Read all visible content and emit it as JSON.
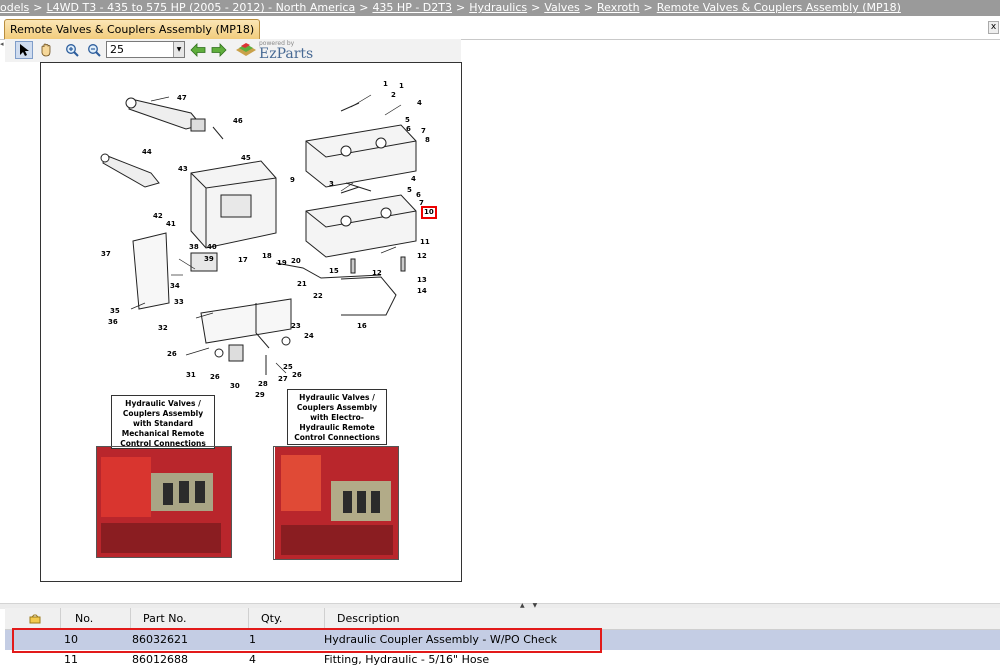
{
  "breadcrumb": {
    "items": [
      "odels",
      "L4WD T3 - 435 to 575 HP (2005 - 2012) - North America",
      "435 HP - D2T3",
      "Hydraulics",
      "Valves",
      "Rexroth",
      "Remote Valves & Couplers Assembly (MP18)"
    ],
    "separator": ">"
  },
  "tab": {
    "title": "Remote Valves & Couplers Assembly (MP18)",
    "close_glyph": "x"
  },
  "toolbar": {
    "zoom_value": "25",
    "logo_powered": "powered by",
    "logo_name": "EzParts",
    "tools": [
      "select-pointer",
      "pan-hand",
      "zoom-in",
      "zoom-out",
      "back-arrow",
      "forward-arrow"
    ]
  },
  "diagram": {
    "part_labels": [
      "1",
      "2",
      "4",
      "5",
      "6",
      "7",
      "8",
      "47",
      "46",
      "44",
      "43",
      "45",
      "9",
      "3",
      "4",
      "5",
      "6",
      "7",
      "10",
      "11",
      "12",
      "13",
      "14",
      "15",
      "12",
      "16",
      "42",
      "41",
      "38",
      "40",
      "39",
      "17",
      "18",
      "19",
      "20",
      "21",
      "22",
      "37",
      "34",
      "33",
      "35",
      "36",
      "32",
      "23",
      "24",
      "25",
      "26",
      "27",
      "28",
      "29",
      "26",
      "31",
      "26",
      "30",
      "1"
    ],
    "highlighted_part": "10",
    "callout_left": "Hydraulic Valves / Couplers Assembly with Standard Mechanical Remote Control Connections",
    "callout_right": "Hydraulic Valves / Couplers Assembly with Electro-Hydraulic Remote Control Connections"
  },
  "grid": {
    "columns": [
      "",
      "No.",
      "Part No.",
      "Qty.",
      "Description"
    ],
    "rows": [
      {
        "no": "10",
        "part_no": "86032621",
        "qty": "1",
        "description": "Hydraulic Coupler Assembly - W/PO Check",
        "selected": true
      },
      {
        "no": "11",
        "part_no": "86012688",
        "qty": "4",
        "description": "Fitting, Hydraulic - 5/16\" Hose",
        "selected": false
      }
    ]
  },
  "colors": {
    "breadcrumb_bg": "#9a9a9a",
    "tab_bg": "#f2cc7c",
    "selection": "#c4cde4",
    "highlight": "#e21a1a"
  }
}
